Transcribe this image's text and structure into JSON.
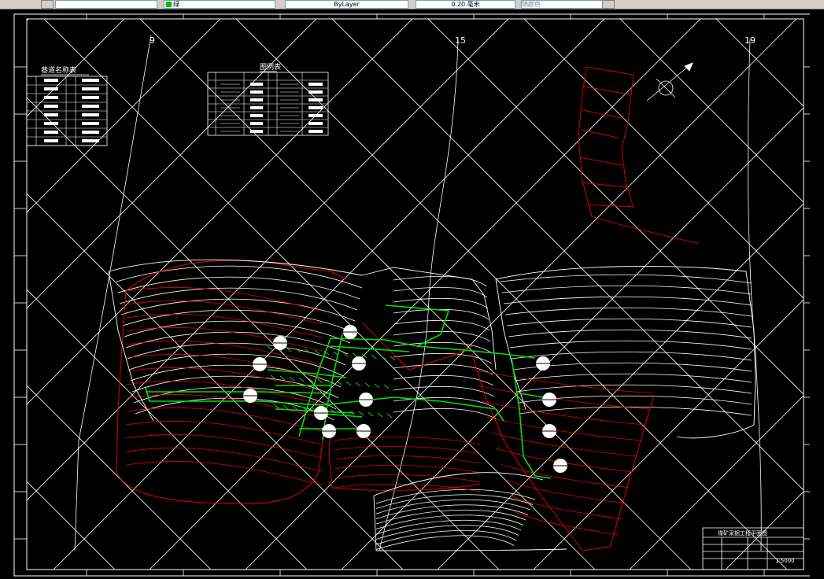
{
  "toolbar": {
    "color_value": "绿",
    "linetype_value": "ByLayer",
    "lineweight_value": "0.20 毫米",
    "plotstyle_value": "随颜色"
  },
  "drawing": {
    "grid_labels": [
      "9",
      "15",
      "19"
    ],
    "legend_left_title": "巷道名称表",
    "legend_center_title": "图例表",
    "title_block_heading": "煤矿采掘工程平面图",
    "scale": "1:5000"
  },
  "colors": {
    "background": "#000000",
    "lines": "#ffffff",
    "contours": "#e00000",
    "roadways": "#00e000"
  }
}
